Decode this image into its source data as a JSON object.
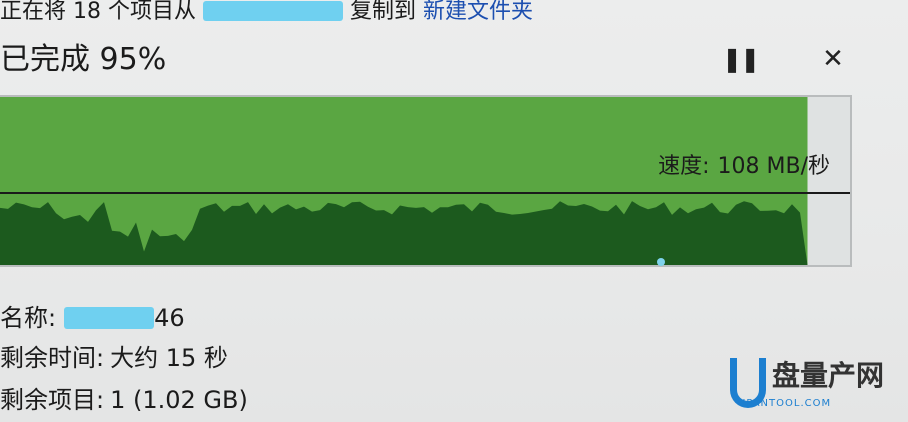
{
  "header": {
    "copy_prefix": "正在将 18 个项目从",
    "copy_middle": "复制到",
    "copy_destination": "新建文件夹",
    "percent_label": "已完成 95%",
    "progress_fraction": 0.95
  },
  "controls": {
    "pause_icon": "pause-icon",
    "close_icon": "close-icon"
  },
  "graph": {
    "speed_label": "速度:",
    "speed_value": "108 MB/秒",
    "fill_color": "#5aa642",
    "throughput_color": "#1c5a1e"
  },
  "details": {
    "name_label": "名称:",
    "name_value": "46",
    "time_label": "剩余时间:",
    "time_value": "大约 15 秒",
    "items_label": "剩余项目:",
    "items_value": "1 (1.02 GB)"
  },
  "watermark": {
    "brand": "盘量产网",
    "url": "UPANTOOL.COM"
  }
}
